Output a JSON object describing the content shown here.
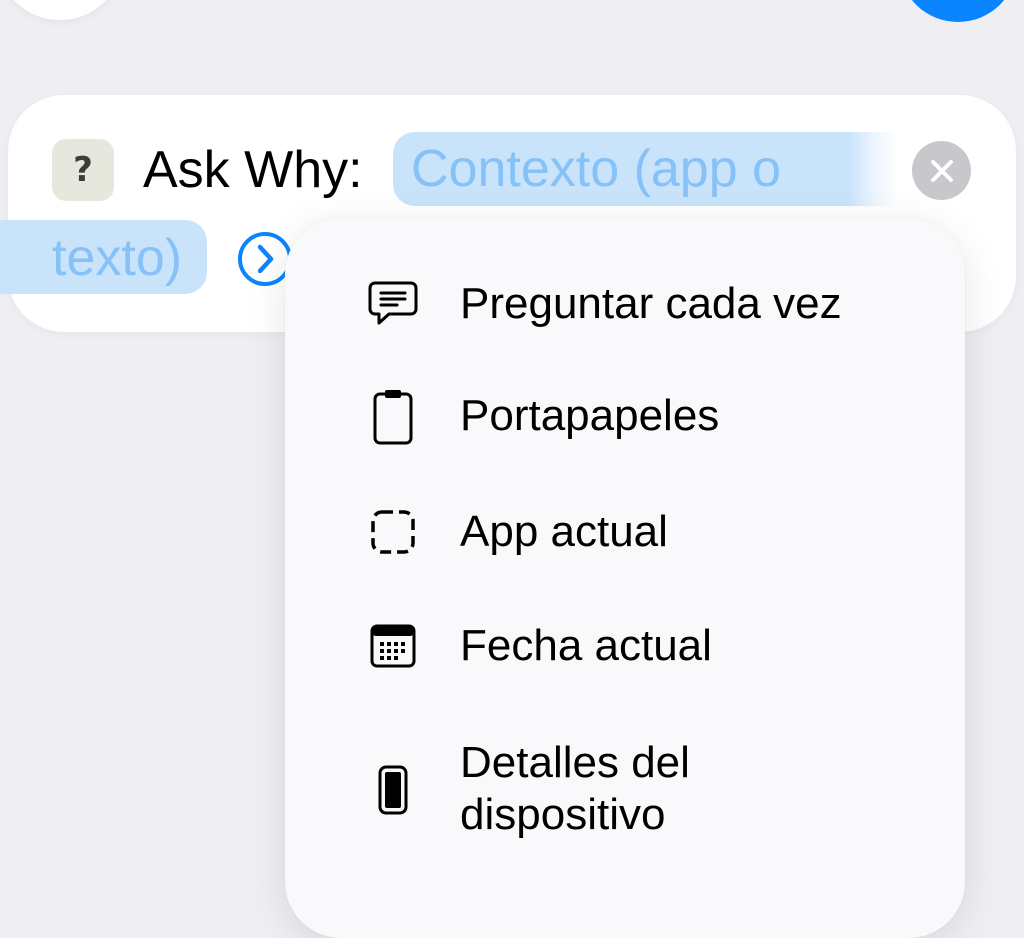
{
  "action": {
    "app_icon_glyph": "?",
    "title": "Ask Why:",
    "parameter_line1": "Contexto (app o",
    "parameter_line2": "texto)"
  },
  "menu": {
    "items": [
      {
        "label": "Preguntar cada vez",
        "icon": "speech-bubble-icon"
      },
      {
        "label": "Portapapeles",
        "icon": "clipboard-icon"
      },
      {
        "label": "App actual",
        "icon": "dashed-square-icon"
      },
      {
        "label": "Fecha actual",
        "icon": "calendar-icon"
      },
      {
        "label_line1": "Detalles del",
        "label_line2": "dispositivo",
        "icon": "iphone-icon"
      }
    ]
  },
  "colors": {
    "background": "#eeeef3",
    "accent": "#0a84ff",
    "token_fill": "#c9e3fb",
    "token_text": "#86c1f7",
    "clear_button": "#c7c7cc"
  }
}
